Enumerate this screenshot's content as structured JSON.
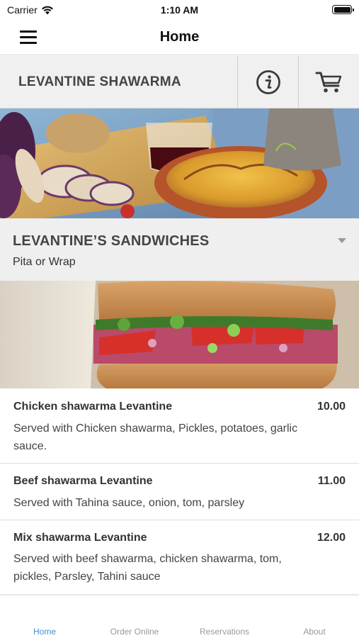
{
  "status_bar": {
    "carrier": "Carrier",
    "time": "1:10 AM"
  },
  "nav": {
    "title": "Home",
    "menu_icon": "hamburger-menu-icon"
  },
  "restaurant": {
    "name": "LEVANTINE SHAWARMA",
    "info_icon": "info-icon",
    "cart_icon": "cart-icon"
  },
  "category": {
    "title": "LEVANTINE’S SANDWICHES",
    "subtitle": "Pita or Wrap",
    "expand_icon": "caret-down-icon"
  },
  "menu_items": [
    {
      "name": "Chicken shawarma Levantine",
      "price": "10.00",
      "description": "Served with Chicken shawarma, Pickles, potatoes, garlic sauce."
    },
    {
      "name": "Beef shawarma Levantine",
      "price": "11.00",
      "description": "Served with Tahina sauce, onion, tom, parsley"
    },
    {
      "name": "Mix shawarma Levantine",
      "price": "12.00",
      "description": "Served with beef shawarma, chicken shawarma, tom, pickles, Parsley, Tahini sauce"
    }
  ],
  "tabs": [
    {
      "label": "Home",
      "active": true
    },
    {
      "label": "Order Online",
      "active": false
    },
    {
      "label": "Reservations",
      "active": false
    },
    {
      "label": "About",
      "active": false
    }
  ],
  "colors": {
    "accent": "#3f8fd8",
    "tab_inactive": "#999999",
    "header_bg": "#f0f0f0"
  }
}
